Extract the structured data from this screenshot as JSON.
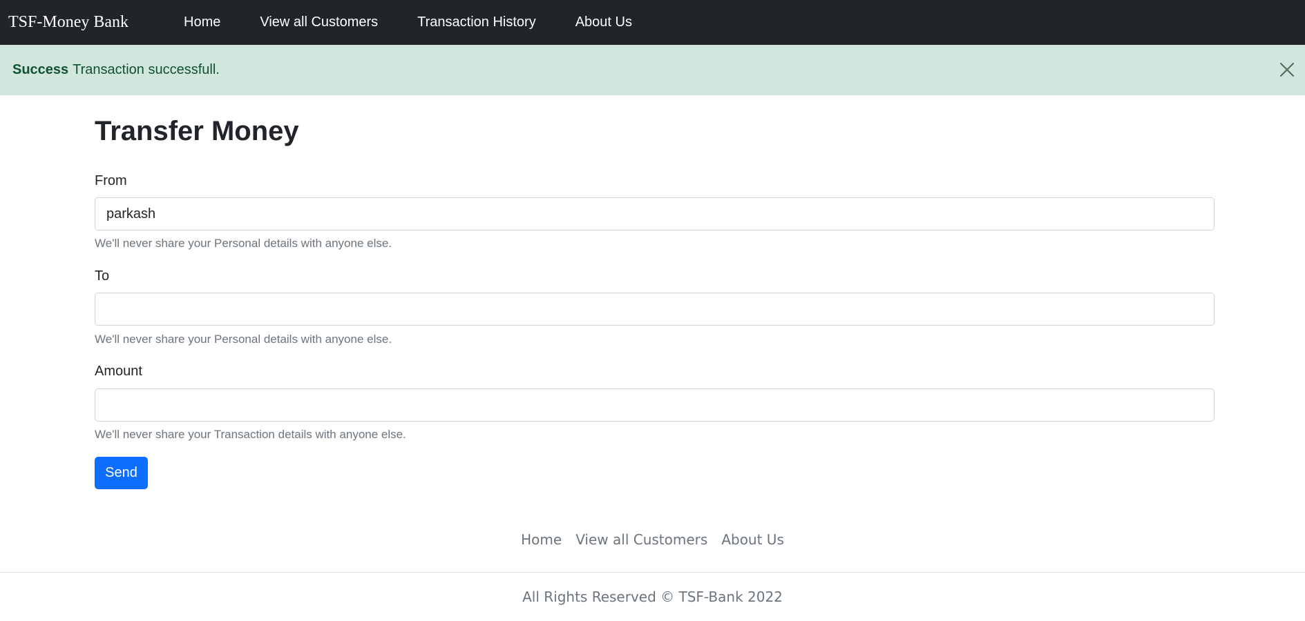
{
  "navbar": {
    "brand": "TSF-Money Bank",
    "links": [
      "Home",
      "View all Customers",
      "Transaction History",
      "About Us"
    ]
  },
  "alert": {
    "strong": "Success",
    "message": "Transaction successfull.",
    "close_icon": "close-icon"
  },
  "form": {
    "title": "Transfer Money",
    "from": {
      "label": "From",
      "value": "parkash",
      "help": "We'll never share your Personal details with anyone else."
    },
    "to": {
      "label": "To",
      "value": "",
      "help": "We'll never share your Personal details with anyone else."
    },
    "amount": {
      "label": "Amount",
      "value": "",
      "help": "We'll never share your Transaction details with anyone else."
    },
    "send_label": "Send"
  },
  "footer": {
    "links": [
      "Home",
      "View all Customers",
      "About Us"
    ],
    "copyright": "All Rights Reserved © TSF-Bank 2022"
  },
  "colors": {
    "navbar_bg": "#212529",
    "alert_bg": "#d1e7dd",
    "alert_text": "#0f5132",
    "primary": "#0d6efd",
    "muted": "#6c757d"
  }
}
